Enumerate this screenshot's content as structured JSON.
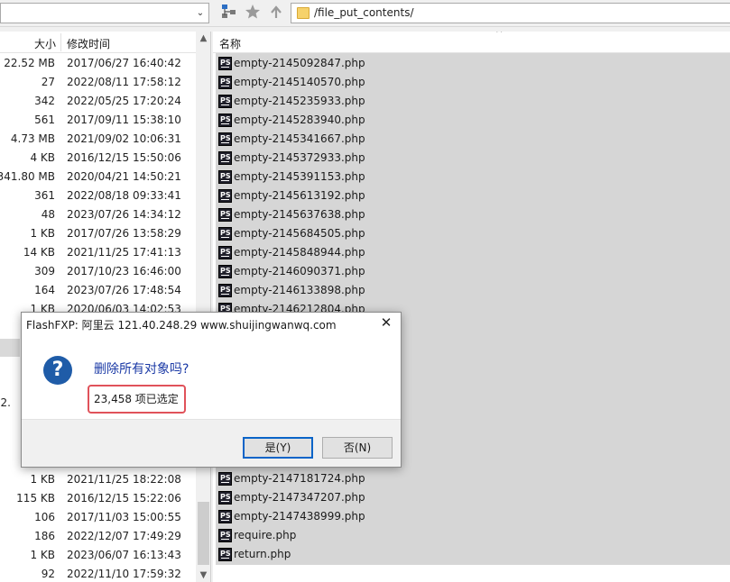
{
  "toolbar": {
    "path": "/file_put_contents/",
    "left_dropdown_glyph": "⌄"
  },
  "left_pane": {
    "col_size": "大小",
    "col_time": "修改时间",
    "rows": [
      {
        "size": "22.52 MB",
        "time": "2017/06/27 16:40:42"
      },
      {
        "size": "27",
        "time": "2022/08/11 17:58:12"
      },
      {
        "size": "342",
        "time": "2022/05/25 17:20:24"
      },
      {
        "size": "561",
        "time": "2017/09/11 15:38:10"
      },
      {
        "size": "4.73 MB",
        "time": "2021/09/02 10:06:31"
      },
      {
        "size": "4 KB",
        "time": "2016/12/15 15:50:06"
      },
      {
        "size": "341.80 MB",
        "time": "2020/04/21 14:50:21"
      },
      {
        "size": "361",
        "time": "2022/08/18 09:33:41"
      },
      {
        "size": "48",
        "time": "2023/07/26 14:34:12"
      },
      {
        "size": "1 KB",
        "time": "2017/07/26 13:58:29"
      },
      {
        "size": "14 KB",
        "time": "2021/11/25 17:41:13"
      },
      {
        "size": "309",
        "time": "2017/10/23 16:46:00"
      },
      {
        "size": "164",
        "time": "2023/07/26 17:48:54"
      },
      {
        "size": "1 KB",
        "time": "2020/06/03 14:02:53"
      }
    ],
    "partial_size": "22.",
    "rows_bottom": [
      {
        "size": "1 KB",
        "time": "2021/11/25 18:22:08"
      },
      {
        "size": "115 KB",
        "time": "2016/12/15 15:22:06"
      },
      {
        "size": "106",
        "time": "2017/11/03 15:00:55"
      },
      {
        "size": "186",
        "time": "2022/12/07 17:49:29"
      },
      {
        "size": "1 KB",
        "time": "2023/06/07 16:13:43"
      },
      {
        "size": "92",
        "time": "2022/11/10 17:59:32"
      }
    ]
  },
  "right_pane": {
    "col_name": "名称",
    "sort_glyph": "^",
    "file_icon_text": "PS",
    "files_top": [
      "empty-2145092847.php",
      "empty-2145140570.php",
      "empty-2145235933.php",
      "empty-2145283940.php",
      "empty-2145341667.php",
      "empty-2145372933.php",
      "empty-2145391153.php",
      "empty-2145613192.php",
      "empty-2145637638.php",
      "empty-2145684505.php",
      "empty-2145848944.php",
      "empty-2146090371.php",
      "empty-2146133898.php",
      "empty-2146212804.php"
    ],
    "files_bottom": [
      "empty-2147181724.php",
      "empty-2147347207.php",
      "empty-2147438999.php",
      "require.php",
      "return.php"
    ]
  },
  "dialog": {
    "title": "FlashFXP: 阿里云 121.40.248.29 www.shuijingwanwq.com",
    "close_glyph": "✕",
    "icon_glyph": "?",
    "message": "删除所有对象吗?",
    "detail": "23,458 项已选定",
    "yes_label": "是(Y)",
    "no_label": "否(N)",
    "highlight_color": "#e0525a"
  }
}
